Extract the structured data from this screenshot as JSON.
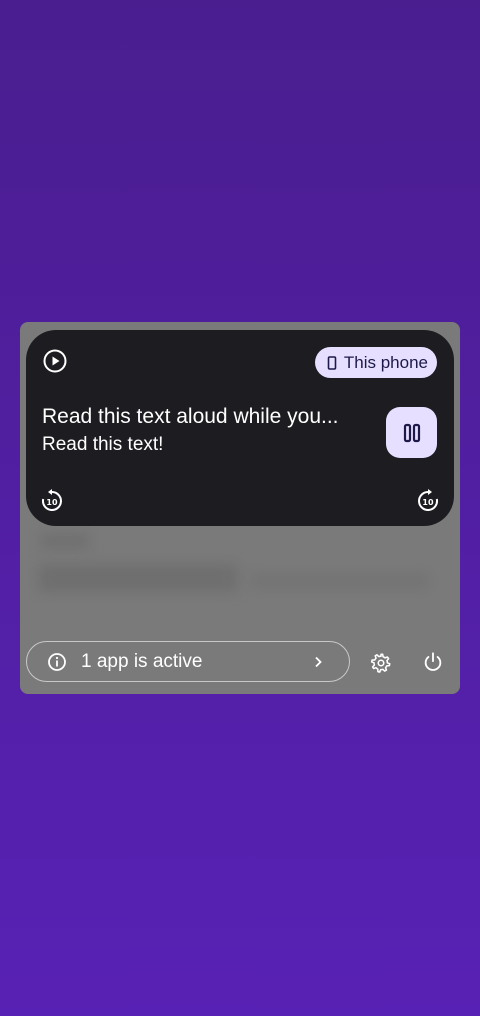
{
  "media": {
    "output_device": "This phone",
    "title": "Read this text aloud while you...",
    "subtitle": "Read this text!"
  },
  "footer": {
    "active_apps_label": "1 app is active"
  },
  "icons": {
    "play": "play-circle-icon",
    "phone": "phone-icon",
    "pause": "pause-icon",
    "rewind": "replay-10-icon",
    "forward": "forward-10-icon",
    "info": "info-icon",
    "chevron": "chevron-right-icon",
    "settings": "gear-icon",
    "power": "power-icon"
  },
  "colors": {
    "accent_chip": "#e6dfff",
    "card_bg": "#1d1c20",
    "panel_bg": "#7a7a7a",
    "wallpaper": "#5220a8"
  }
}
